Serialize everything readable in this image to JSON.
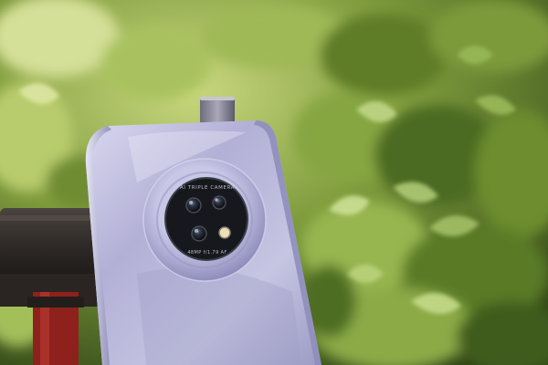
{
  "photo": {
    "subject": "smartphone-rear-with-pop-up-camera",
    "camera_text_top": "AI TRIPLE CAMERA",
    "camera_text_bottom": "48MP  f/1.79  AF"
  },
  "colors": {
    "foliage_light": "#c7d98a",
    "foliage_mid": "#7fa043",
    "foliage_dark": "#3d5a1c",
    "phone_body": "#b4b2d6",
    "phone_highlight": "#dcdcf2",
    "camera_ring": "#a9a7cf",
    "camera_module": "#16181d",
    "rail": "#3b3532",
    "post_red": "#a0261f"
  }
}
